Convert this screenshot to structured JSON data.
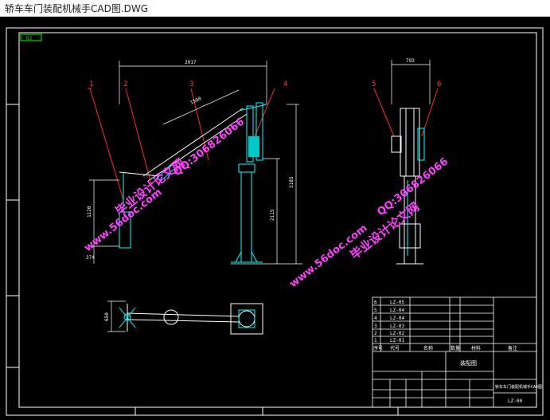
{
  "window": {
    "title": "轿车车门装配机械手CAD图.DWG"
  },
  "drawing": {
    "corner_tag": "0J",
    "dimensions": {
      "top_width": "2917",
      "arm_length": "1500",
      "left_height": "1120",
      "left_small": "374",
      "column_height": "2115",
      "total_height": "3185",
      "side_width": "793",
      "plan_width": "650"
    },
    "balloons": [
      "1",
      "2",
      "3",
      "4",
      "5",
      "6"
    ]
  },
  "watermarks": {
    "site_name": "毕业设计论文网",
    "site_url": "www.56doc.com",
    "qq": "QQ:306826066"
  },
  "title_block": {
    "parts": [
      {
        "no": "6",
        "code": "LZ-05"
      },
      {
        "no": "5",
        "code": "LZ-04"
      },
      {
        "no": "4",
        "code": "LZ-04"
      },
      {
        "no": "3",
        "code": "LZ-03"
      },
      {
        "no": "2",
        "code": "LZ-02"
      },
      {
        "no": "1",
        "code": "LZ-01"
      }
    ],
    "header": [
      "序号",
      "代号",
      "名称",
      "数量",
      "材料",
      "备注"
    ],
    "drawing_name": "装配图",
    "product_name": "轿车车门装配机械手CAD图",
    "drawing_no": "LZ-00"
  }
}
